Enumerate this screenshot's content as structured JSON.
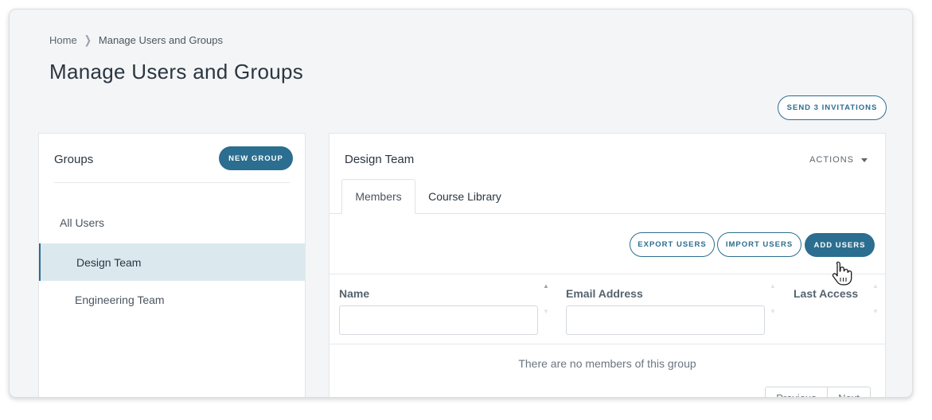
{
  "breadcrumb": {
    "home": "Home",
    "current": "Manage Users and Groups"
  },
  "page": {
    "title": "Manage Users and Groups",
    "send_invitations": "SEND 3 INVITATIONS"
  },
  "groups": {
    "title": "Groups",
    "new_group": "NEW GROUP",
    "items": [
      {
        "label": "All Users",
        "selected": false
      },
      {
        "label": "Design Team",
        "selected": true
      },
      {
        "label": "Engineering Team",
        "selected": false
      }
    ]
  },
  "team": {
    "title": "Design Team",
    "actions": "ACTIONS",
    "tabs": [
      {
        "label": "Members",
        "active": true
      },
      {
        "label": "Course Library",
        "active": false
      }
    ],
    "buttons": {
      "export": "EXPORT USERS",
      "import": "IMPORT USERS",
      "add": "ADD USERS"
    },
    "columns": [
      {
        "label": "Name"
      },
      {
        "label": "Email Address"
      },
      {
        "label": "Last Access"
      }
    ],
    "empty_message": "There are no members of this group",
    "pager": {
      "prev": "Previous",
      "next": "Next"
    }
  },
  "colors": {
    "accent": "#2b6e8f",
    "selected_bg": "#dbe9ef",
    "window_bg": "#f4f5f7"
  },
  "icons": {
    "breadcrumb_separator": "chevron-right-icon",
    "actions_caret": "caret-down-icon",
    "sort": "sort-arrows-icon",
    "cursor": "hand-pointer-cursor-icon"
  }
}
